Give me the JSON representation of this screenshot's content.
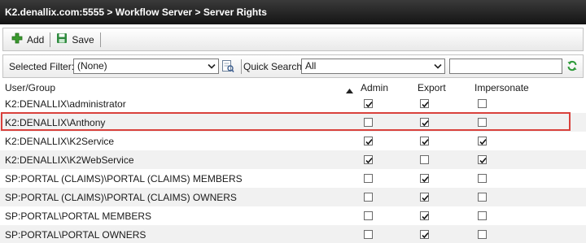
{
  "titlebar": {
    "breadcrumb": "K2.denallix.com:5555 > Workflow Server > Server Rights"
  },
  "toolbar": {
    "add_label": "Add",
    "save_label": "Save"
  },
  "filter": {
    "selected_filter_label": "Selected Filter:",
    "selected_filter_value": "(None)",
    "quick_search_label": "Quick Search:",
    "quick_search_value": "All",
    "search_text": ""
  },
  "grid": {
    "columns": [
      "User/Group",
      "Admin",
      "Export",
      "Impersonate"
    ],
    "sorted_column": "User/Group",
    "highlighted_row": 1,
    "rows": [
      {
        "name": "K2:DENALLIX\\administrator",
        "admin": true,
        "export": true,
        "impersonate": false
      },
      {
        "name": "K2:DENALLIX\\Anthony",
        "admin": false,
        "export": true,
        "impersonate": false
      },
      {
        "name": "K2:DENALLIX\\K2Service",
        "admin": true,
        "export": true,
        "impersonate": true
      },
      {
        "name": "K2:DENALLIX\\K2WebService",
        "admin": true,
        "export": false,
        "impersonate": true
      },
      {
        "name": "SP:PORTAL (CLAIMS)\\PORTAL (CLAIMS) MEMBERS",
        "admin": false,
        "export": true,
        "impersonate": false
      },
      {
        "name": "SP:PORTAL (CLAIMS)\\PORTAL (CLAIMS) OWNERS",
        "admin": false,
        "export": true,
        "impersonate": false
      },
      {
        "name": "SP:PORTAL\\PORTAL MEMBERS",
        "admin": false,
        "export": true,
        "impersonate": false
      },
      {
        "name": "SP:PORTAL\\PORTAL OWNERS",
        "admin": false,
        "export": true,
        "impersonate": false
      }
    ]
  },
  "colors": {
    "title_bg": "#1f1f1f",
    "highlight_border": "#d9413c",
    "add_icon": "#3a9a2e",
    "save_icon": "#2e8a3e",
    "refresh_icon": "#2f9a3a"
  }
}
